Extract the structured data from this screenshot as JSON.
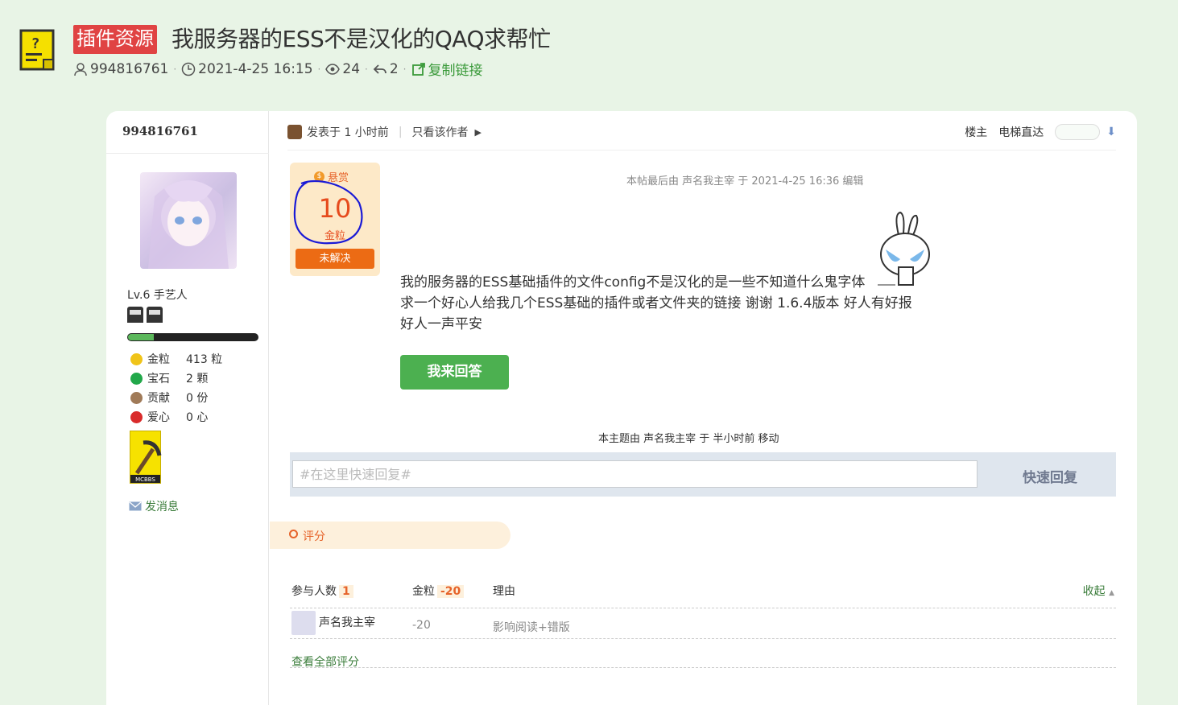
{
  "topic": {
    "category": "插件资源",
    "title": "我服务器的ESS不是汉化的QAQ求帮忙"
  },
  "meta": {
    "author": "994816761",
    "datetime": "2021-4-25 16:15",
    "views": "24",
    "replies": "2",
    "copy_link": "复制链接"
  },
  "author_panel": {
    "name": "994816761",
    "level": "Lv.6 手艺人",
    "exp_progress": 0.2,
    "stats": [
      {
        "label": "金粒",
        "value": "413 粒",
        "color": "#f0c419"
      },
      {
        "label": "宝石",
        "value": "2 颗",
        "color": "#22a84a"
      },
      {
        "label": "贡献",
        "value": "0 份",
        "color": "#a07a58"
      },
      {
        "label": "爱心",
        "value": "0 心",
        "color": "#d92b2b"
      }
    ],
    "badge_text": "MCBBS",
    "send_message": "发消息"
  },
  "post": {
    "posted": "发表于 1 小时前",
    "author_only": "只看该作者",
    "floor": "楼主",
    "elevator": "电梯直达",
    "edited_note": "本帖最后由 声名我主宰 于 2021-4-25 16:36 编辑",
    "body_lines": [
      "我的服务器的ESS基础插件的文件config不是汉化的是一些不知道什么鬼字体",
      "求一个好心人给我几个ESS基础的插件或者文件夹的链接 谢谢 1.6.4版本 好人有好报",
      "好人一声平安"
    ],
    "reply_button": "我来回答",
    "moved_note": "本主题由 声名我主宰 于 半小时前 移动"
  },
  "bounty": {
    "label": "悬赏",
    "amount": "10",
    "unit": "金粒",
    "status": "未解决"
  },
  "quick_reply": {
    "placeholder": "#在这里快速回复#",
    "button": "快速回复"
  },
  "rating": {
    "tab_label": "评分",
    "header_participants": "参与人数",
    "participants": "1",
    "header_gold": "金粒",
    "gold_total": "-20",
    "header_reason": "理由",
    "collapse": "收起",
    "rows": [
      {
        "user": "声名我主宰",
        "gold": "-20",
        "reason": "影响阅读+错版"
      }
    ],
    "view_all": "查看全部评分"
  }
}
